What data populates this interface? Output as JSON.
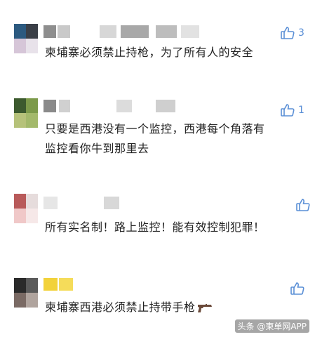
{
  "comments": [
    {
      "text": "柬埔寨必须禁止持枪，为了所有人的安全",
      "likes": "3"
    },
    {
      "text_line1": "只要是西港没有一个监控，西港每个角落有",
      "text_line2": "监控看你牛到那里去",
      "likes": "1"
    },
    {
      "text": "所有实名制！路上监控！能有效控制犯罪！",
      "likes": ""
    },
    {
      "text": "柬埔寨西港必须禁止持带手枪",
      "likes": "",
      "trailing_icon": "pistol-icon"
    }
  ],
  "watermark": "头条 @柬单网APP",
  "colors": {
    "like_icon": "#5a8fd6",
    "text": "#222222"
  }
}
